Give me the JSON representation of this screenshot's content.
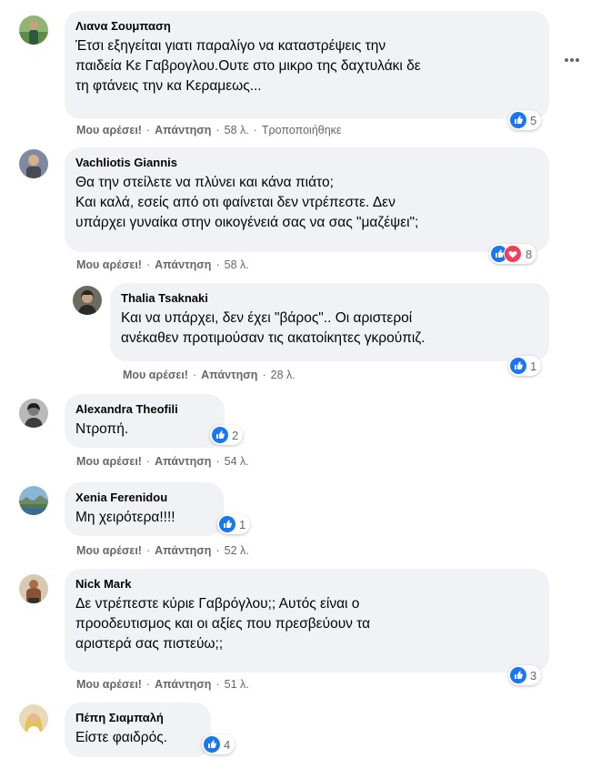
{
  "labels": {
    "like": "Μου αρέσει!",
    "reply": "Απάντηση",
    "sep": "·"
  },
  "colors": {
    "bubble": "#f0f2f5",
    "meta": "#65676b",
    "like": "#1877f2",
    "love": "#f33e58"
  },
  "comments": [
    {
      "author": "Λιανα Σουμπαση",
      "lines": [
        "Έτσι εξηγείται γιατι παραλίγο να καταστρέψεις την",
        "παιδεία Κε Γαβρογλου.Ουτε στο μικρο της δαχτυλάκι δε",
        "τη φτάνεις την κα Κεραμεως..."
      ],
      "time": "58 λ.",
      "edited": "Τροποποιήθηκε",
      "reactions": {
        "types": [
          "like"
        ],
        "count": "5"
      }
    },
    {
      "author": "Vachliotis Giannis",
      "lines": [
        "Θα την στείλετε να πλύνει και κάνα πιάτο;",
        "Και καλά, εσείς από οτι φαίνεται δεν ντρέπεστε. Δεν",
        "υπάρχει γυναίκα στην οικογένειά σας να σας \"μαζέψει\";"
      ],
      "time": "58 λ.",
      "reactions": {
        "types": [
          "like",
          "love"
        ],
        "count": "8"
      }
    },
    {
      "author": "Thalia Tsaknaki",
      "lines": [
        "Και να υπάρχει, δεν έχει \"βάρος\".. Οι αριστεροί",
        "ανέκαθεν προτιμούσαν τις ακατοίκητες γκρούπιζ."
      ],
      "time": "28 λ.",
      "reactions": {
        "types": [
          "like"
        ],
        "count": "1"
      }
    },
    {
      "author": "Alexandra Theofili",
      "lines": [
        "Ντροπή."
      ],
      "time": "54 λ.",
      "reactions": {
        "types": [
          "like"
        ],
        "count": "2"
      }
    },
    {
      "author": "Xenia Ferenidou",
      "lines": [
        "Μη χειρότερα!!!!"
      ],
      "time": "52 λ.",
      "reactions": {
        "types": [
          "like"
        ],
        "count": "1"
      }
    },
    {
      "author": "Nick Mark",
      "lines": [
        "Δε ντρέπεστε κύριε Γαβρόγλου;; Αυτός είναι ο",
        "προοδευτισμος και οι αξίες που πρεσβεύουν τα",
        "αριστερά σας πιστεύω;;"
      ],
      "time": "51 λ.",
      "reactions": {
        "types": [
          "like"
        ],
        "count": "3"
      }
    },
    {
      "author": "Πέπη Σιαμπαλή",
      "lines": [
        "Είστε φαιδρός."
      ],
      "reactions": {
        "types": [
          "like"
        ],
        "count": "4"
      }
    }
  ]
}
